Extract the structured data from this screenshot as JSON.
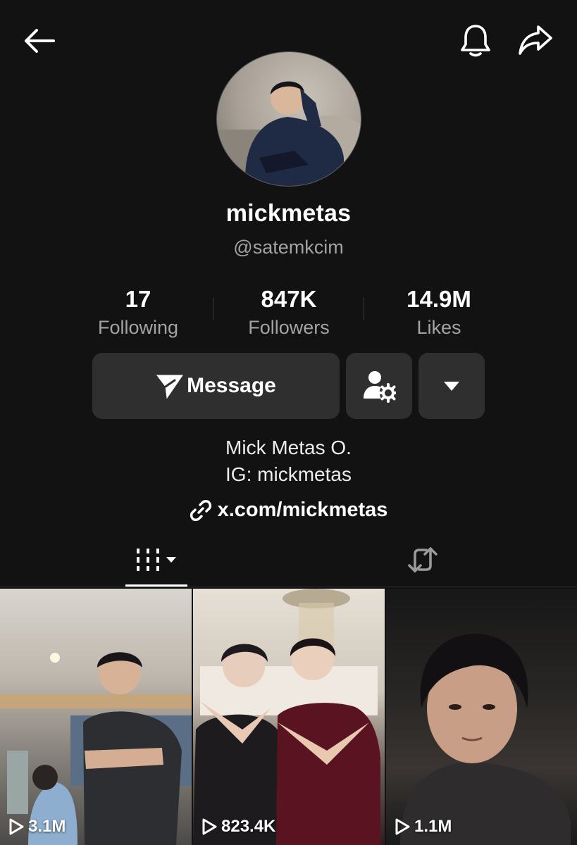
{
  "profile": {
    "display_name": "mickmetas",
    "handle": "@satemkcim"
  },
  "stats": [
    {
      "value": "17",
      "label": "Following"
    },
    {
      "value": "847K",
      "label": "Followers"
    },
    {
      "value": "14.9M",
      "label": "Likes"
    }
  ],
  "actions": {
    "message_label": "Message",
    "message_icon": "send-icon",
    "friend_icon": "user-settings-icon",
    "more_icon": "caret-down-icon"
  },
  "bio": {
    "line1": "Mick Metas O.",
    "line2": "IG: mickmetas",
    "link": "x.com/mickmetas"
  },
  "tabs": {
    "videos_icon": "grid-icon",
    "reposts_icon": "repost-icon"
  },
  "videos": [
    {
      "views": "3.1M"
    },
    {
      "views": "823.4K"
    },
    {
      "views": "1.1M"
    }
  ],
  "colors": {
    "background": "#121212",
    "button": "#2f2f2f",
    "secondary_text": "#a3a3a3"
  }
}
